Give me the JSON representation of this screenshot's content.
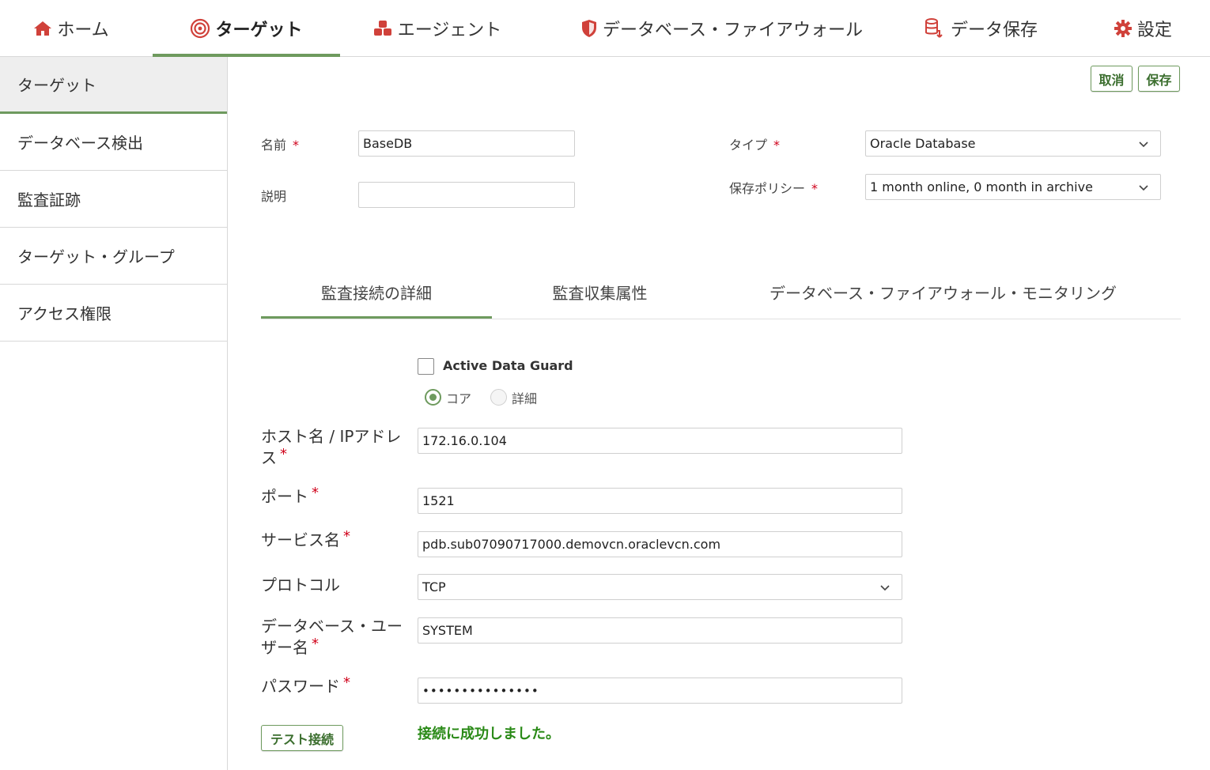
{
  "nav": {
    "home": "ホーム",
    "targets": "ターゲット",
    "agents": "エージェント",
    "firewall": "データベース・ファイアウォール",
    "retention": "データ保存",
    "settings": "設定"
  },
  "sidebar": {
    "items": [
      {
        "label": "ターゲット",
        "active": true
      },
      {
        "label": "データベース検出"
      },
      {
        "label": "監査証跡"
      },
      {
        "label": "ターゲット・グループ"
      },
      {
        "label": "アクセス権限"
      }
    ]
  },
  "actions": {
    "cancel": "取消",
    "save": "保存"
  },
  "form": {
    "name_label": "名前",
    "name_value": "BaseDB",
    "desc_label": "説明",
    "desc_value": "",
    "type_label": "タイプ",
    "type_value": "Oracle Database",
    "policy_label": "保存ポリシー",
    "policy_value": "1 month online, 0 month in archive",
    "required_mark": "*"
  },
  "tabs": [
    {
      "label": "監査接続の詳細",
      "active": true
    },
    {
      "label": "監査収集属性"
    },
    {
      "label": "データベース・ファイアウォール・モニタリング"
    }
  ],
  "connection": {
    "adg_label": "Active Data Guard",
    "mode_core": "コア",
    "mode_detail": "詳細",
    "host_label_1": "ホスト名 / IPアドレ",
    "host_label_2": "ス",
    "host_value": "172.16.0.104",
    "port_label": "ポート",
    "port_value": "1521",
    "service_label": "サービス名",
    "service_value": "pdb.sub07090717000.demovcn.oraclevcn.com",
    "protocol_label": "プロトコル",
    "protocol_value": "TCP",
    "user_label_1": "データベース・ユー",
    "user_label_2": "ザー名",
    "user_value": "SYSTEM",
    "password_label": "パスワード",
    "password_value": "•••••••••••••••",
    "test_button": "テスト接続",
    "success_message": "接続に成功しました。"
  },
  "colors": {
    "accent": "#6e9a5e",
    "icon_red": "#d0413a",
    "success": "#2a8a17",
    "required": "#d0021b"
  }
}
